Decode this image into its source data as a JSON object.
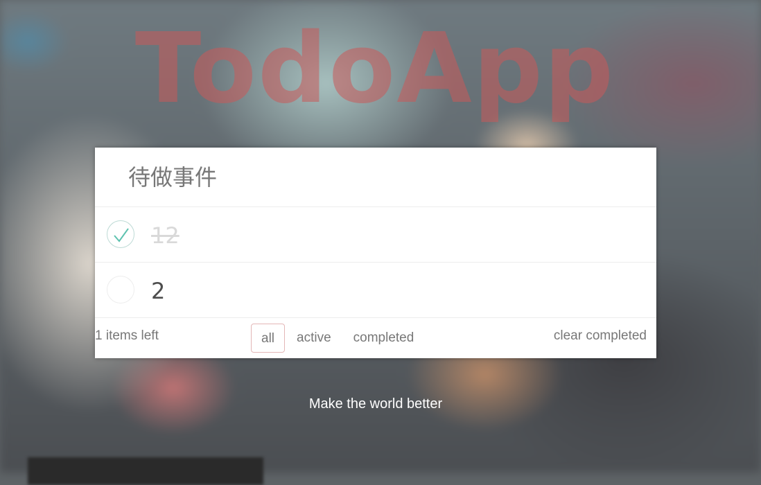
{
  "app": {
    "logo": "TodoApp",
    "tagline": "Make the world better"
  },
  "new_todo": {
    "placeholder": "待做事件"
  },
  "todos": [
    {
      "label": "12",
      "completed": true
    },
    {
      "label": "2",
      "completed": false
    }
  ],
  "footer": {
    "items_left": "1 items left",
    "filters": [
      "all",
      "active",
      "completed"
    ],
    "selected_filter": "all",
    "clear_completed": "clear completed"
  },
  "colors": {
    "logo": "#c85a5a",
    "check": "#5dc2af",
    "filter_border": "#d9a0a0"
  }
}
